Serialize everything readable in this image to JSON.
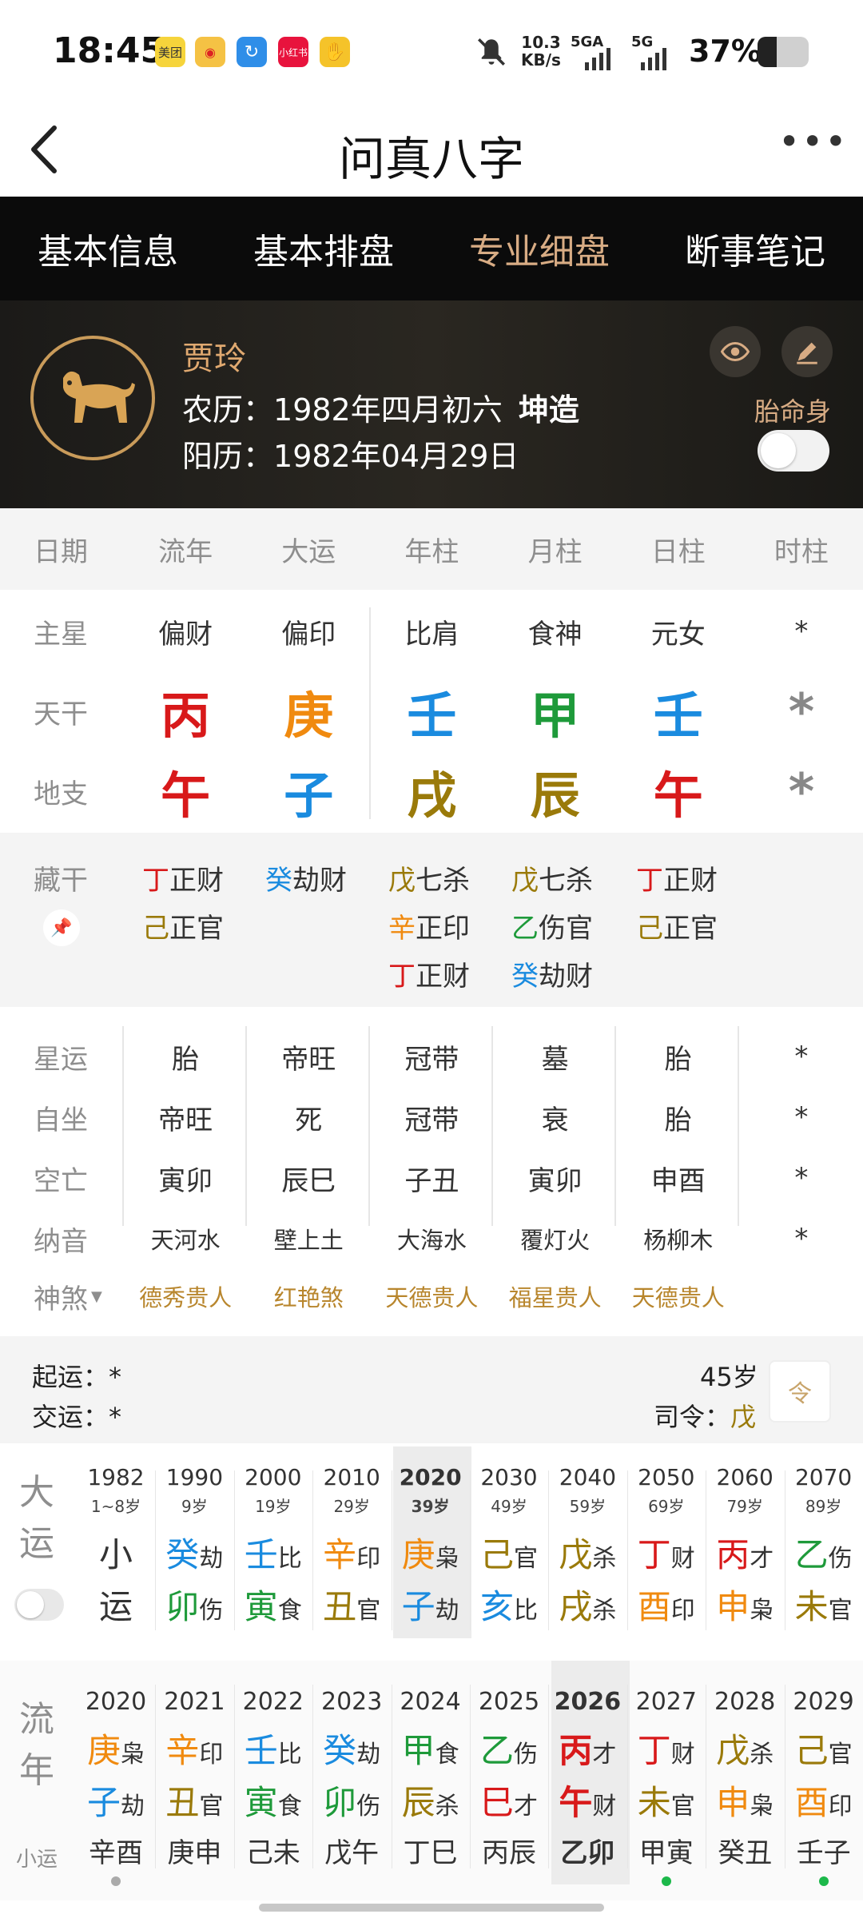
{
  "status": {
    "time": "18:45",
    "speed": "10.3",
    "speed_unit": "KB/s",
    "net1": "5GA",
    "net2": "5G",
    "battery": "37%",
    "apps": [
      "美团",
      "微博",
      "",
      "小红书",
      ""
    ]
  },
  "nav": {
    "title": "问真八字"
  },
  "tabs": [
    "基本信息",
    "基本排盘",
    "专业细盘",
    "断事笔记"
  ],
  "profile": {
    "name": "贾玲",
    "lunar_label": "农历：",
    "lunar": "1982年四月初六",
    "gender": "坤造",
    "solar_label": "阳历：",
    "solar": "1982年04月29日",
    "toggle_label": "胎命身"
  },
  "header_cols": [
    "日期",
    "流年",
    "大运",
    "年柱",
    "月柱",
    "日柱",
    "时柱"
  ],
  "main": {
    "rows": [
      {
        "label": "主星",
        "vals": [
          "偏财",
          "偏印",
          "比肩",
          "食神",
          "元女",
          "*"
        ]
      },
      {
        "label": "天干",
        "vals": [
          "丙",
          "庚",
          "壬",
          "甲",
          "壬",
          "*"
        ]
      },
      {
        "label": "地支",
        "vals": [
          "午",
          "子",
          "戌",
          "辰",
          "午",
          "*"
        ]
      }
    ]
  },
  "cang": {
    "label": "藏干",
    "cols": [
      [
        {
          "c": "丁",
          "t": "正财"
        },
        {
          "c": "己",
          "t": "正官"
        }
      ],
      [
        {
          "c": "癸",
          "t": "劫财"
        }
      ],
      [
        {
          "c": "戊",
          "t": "七杀"
        },
        {
          "c": "辛",
          "t": "正印"
        },
        {
          "c": "丁",
          "t": "正财"
        }
      ],
      [
        {
          "c": "戊",
          "t": "七杀"
        },
        {
          "c": "乙",
          "t": "伤官"
        },
        {
          "c": "癸",
          "t": "劫财"
        }
      ],
      [
        {
          "c": "丁",
          "t": "正财"
        },
        {
          "c": "己",
          "t": "正官"
        }
      ]
    ]
  },
  "detail": [
    {
      "label": "星运",
      "vals": [
        "胎",
        "帝旺",
        "冠带",
        "墓",
        "胎",
        "*"
      ]
    },
    {
      "label": "自坐",
      "vals": [
        "帝旺",
        "死",
        "冠带",
        "衰",
        "胎",
        "*"
      ]
    },
    {
      "label": "空亡",
      "vals": [
        "寅卯",
        "辰巳",
        "子丑",
        "寅卯",
        "申酉",
        "*"
      ]
    },
    {
      "label": "纳音",
      "vals": [
        "天河水",
        "壁上土",
        "大海水",
        "覆灯火",
        "杨柳木",
        "*"
      ]
    }
  ],
  "shensha": {
    "label": "神煞",
    "vals": [
      "德秀贵人",
      "红艳煞",
      "天德贵人",
      "福星贵人",
      "天德贵人"
    ]
  },
  "yun": {
    "qi_label": "起运：",
    "qi": "*",
    "jiao_label": "交运：",
    "jiao": "*",
    "age": "45岁",
    "siling_label": "司令：",
    "siling": "戊",
    "icon_char": "令"
  },
  "dayun": {
    "label": "大运",
    "cols": [
      {
        "year": "1982",
        "age": "1~8岁",
        "g": "小",
        "gs": "",
        "z": "运",
        "zs": ""
      },
      {
        "year": "1990",
        "age": "9岁",
        "g": "癸",
        "gs": "劫",
        "z": "卯",
        "zs": "伤"
      },
      {
        "year": "2000",
        "age": "19岁",
        "g": "壬",
        "gs": "比",
        "z": "寅",
        "zs": "食"
      },
      {
        "year": "2010",
        "age": "29岁",
        "g": "辛",
        "gs": "印",
        "z": "丑",
        "zs": "官"
      },
      {
        "year": "2020",
        "age": "39岁",
        "g": "庚",
        "gs": "枭",
        "z": "子",
        "zs": "劫"
      },
      {
        "year": "2030",
        "age": "49岁",
        "g": "己",
        "gs": "官",
        "z": "亥",
        "zs": "比"
      },
      {
        "year": "2040",
        "age": "59岁",
        "g": "戊",
        "gs": "杀",
        "z": "戌",
        "zs": "杀"
      },
      {
        "year": "2050",
        "age": "69岁",
        "g": "丁",
        "gs": "财",
        "z": "酉",
        "zs": "印"
      },
      {
        "year": "2060",
        "age": "79岁",
        "g": "丙",
        "gs": "才",
        "z": "申",
        "zs": "枭"
      },
      {
        "year": "2070",
        "age": "89岁",
        "g": "乙",
        "gs": "伤",
        "z": "未",
        "zs": "官"
      }
    ]
  },
  "liunian": {
    "label1": "流",
    "label2": "年",
    "xiao": "小运",
    "cols": [
      {
        "year": "2020",
        "g": "庚",
        "gs": "枭",
        "z": "子",
        "zs": "劫",
        "x": "辛酉"
      },
      {
        "year": "2021",
        "g": "辛",
        "gs": "印",
        "z": "丑",
        "zs": "官",
        "x": "庚申"
      },
      {
        "year": "2022",
        "g": "壬",
        "gs": "比",
        "z": "寅",
        "zs": "食",
        "x": "己未"
      },
      {
        "year": "2023",
        "g": "癸",
        "gs": "劫",
        "z": "卯",
        "zs": "伤",
        "x": "戊午"
      },
      {
        "year": "2024",
        "g": "甲",
        "gs": "食",
        "z": "辰",
        "zs": "杀",
        "x": "丁巳"
      },
      {
        "year": "2025",
        "g": "乙",
        "gs": "伤",
        "z": "巳",
        "zs": "才",
        "x": "丙辰"
      },
      {
        "year": "2026",
        "g": "丙",
        "gs": "才",
        "z": "午",
        "zs": "财",
        "x": "乙卯"
      },
      {
        "year": "2027",
        "g": "丁",
        "gs": "财",
        "z": "未",
        "zs": "官",
        "x": "甲寅"
      },
      {
        "year": "2028",
        "g": "戊",
        "gs": "杀",
        "z": "申",
        "zs": "枭",
        "x": "癸丑"
      },
      {
        "year": "2029",
        "g": "己",
        "gs": "官",
        "z": "酉",
        "zs": "印",
        "x": "壬子"
      }
    ]
  }
}
